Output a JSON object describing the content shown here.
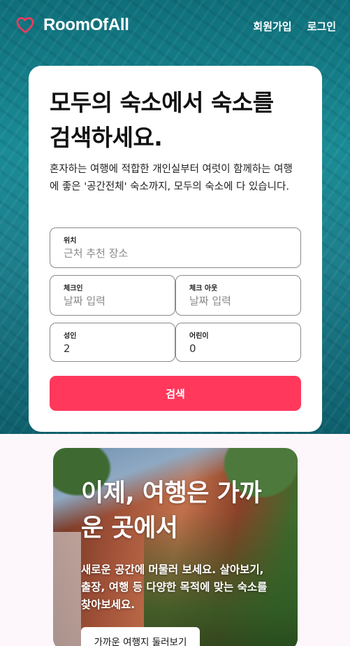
{
  "header": {
    "brand": "RoomOfAll",
    "signup_label": "회원가입",
    "login_label": "로그인",
    "accent_color": "#ff385c"
  },
  "search_card": {
    "title": "모두의 숙소에서 숙소를 검색하세요.",
    "description": "혼자하는 여행에 적합한 개인실부터 여럿이 함께하는 여행에 좋은 '공간전체' 숙소까지, 모두의 숙소에 다 있습니다.",
    "location": {
      "label": "위치",
      "placeholder": "근처 추천 장소"
    },
    "checkin": {
      "label": "체크인",
      "placeholder": "날짜 입력"
    },
    "checkout": {
      "label": "체크 아웃",
      "placeholder": "날짜 입력"
    },
    "adults": {
      "label": "성인",
      "value": "2"
    },
    "children": {
      "label": "어린이",
      "value": "0"
    },
    "search_label": "검색"
  },
  "promo": {
    "title": "이제, 여행은 가까운 곳에서",
    "description": "새로운 공간에 머물러 보세요. 살아보기, 출장, 여행 등 다양한 목적에 맞는 숙소를 찾아보세요.",
    "cta_label": "가까운 여행지 둘러보기"
  },
  "icons": {
    "logo": "heart-icon"
  }
}
